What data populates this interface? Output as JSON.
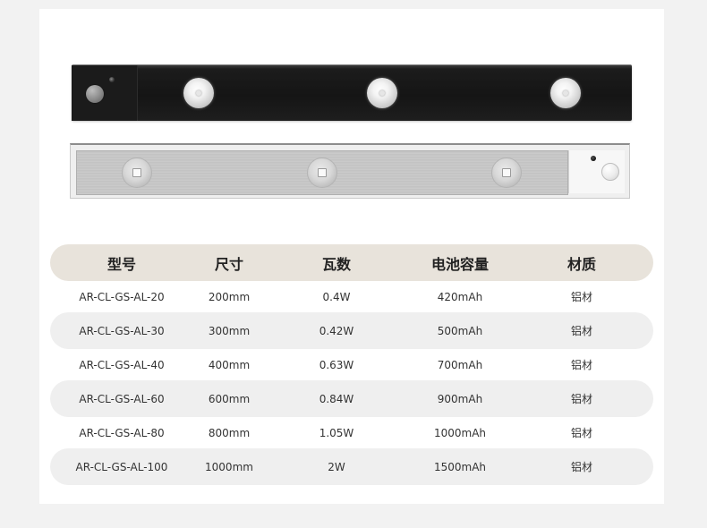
{
  "table": {
    "headers": [
      "型号",
      "尺寸",
      "瓦数",
      "电池容量",
      "材质"
    ],
    "rows": [
      [
        "AR-CL-GS-AL-20",
        "200mm",
        "0.4W",
        "420mAh",
        "铝材"
      ],
      [
        "AR-CL-GS-AL-30",
        "300mm",
        "0.42W",
        "500mAh",
        "铝材"
      ],
      [
        "AR-CL-GS-AL-40",
        "400mm",
        "0.63W",
        "700mAh",
        "铝材"
      ],
      [
        "AR-CL-GS-AL-60",
        "600mm",
        "0.84W",
        "900mAh",
        "铝材"
      ],
      [
        "AR-CL-GS-AL-80",
        "800mm",
        "1.05W",
        "1000mAh",
        "铝材"
      ],
      [
        "AR-CL-GS-AL-100",
        "1000mm",
        "2W",
        "1500mAh",
        "铝材"
      ]
    ]
  },
  "colors": {
    "header_bg": "#e8e3db",
    "shaded_row_bg": "#efefef",
    "black_bar": "#151515",
    "silver_bar": "#c9c9c9"
  },
  "icons": {
    "led": "led-lens-icon",
    "sensor": "motion-sensor-icon",
    "button": "round-switch-icon"
  }
}
